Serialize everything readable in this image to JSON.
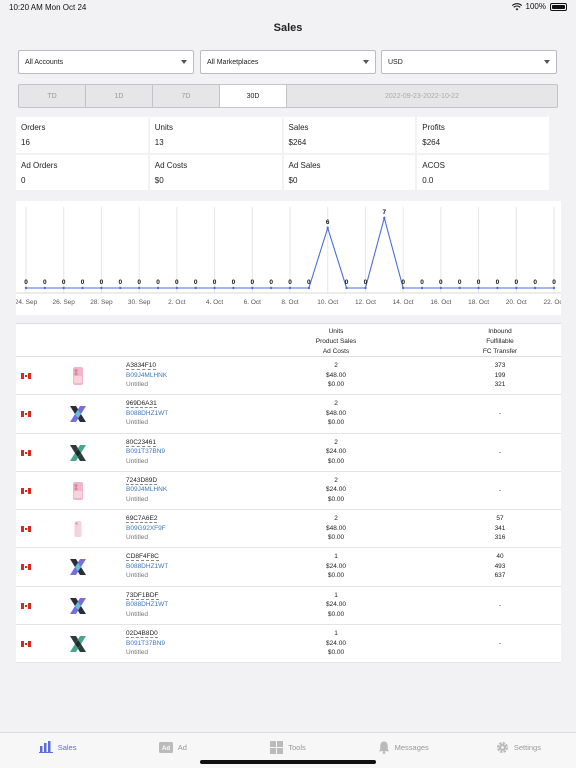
{
  "status": {
    "time": "10:20 AM",
    "date": "Mon Oct 24",
    "battery": "100%"
  },
  "title": "Sales",
  "filters": {
    "accounts": "All Accounts",
    "marketplaces": "All Marketplaces",
    "currency": "USD"
  },
  "periods": [
    "TD",
    "1D",
    "7D",
    "30D"
  ],
  "range": "2022-09-23-2022-10-22",
  "stats": [
    {
      "label": "Orders",
      "value": "16"
    },
    {
      "label": "Units",
      "value": "13"
    },
    {
      "label": "Sales",
      "value": "$264"
    },
    {
      "label": "Profits",
      "value": "$264"
    },
    {
      "label": "Ad Orders",
      "value": "0"
    },
    {
      "label": "Ad Costs",
      "value": "$0"
    },
    {
      "label": "Ad Sales",
      "value": "$0"
    },
    {
      "label": "ACOS",
      "value": "0.0"
    }
  ],
  "chart_data": {
    "type": "line",
    "x": [
      "24. Sep",
      "25. Sep",
      "26. Sep",
      "27. Sep",
      "28. Sep",
      "29. Sep",
      "30. Sep",
      "1. Oct",
      "2. Oct",
      "3. Oct",
      "4. Oct",
      "5. Oct",
      "6. Oct",
      "7. Oct",
      "8. Oct",
      "9. Oct",
      "10. Oct",
      "11. Oct",
      "12. Oct",
      "13. Oct",
      "14. Oct",
      "15. Oct",
      "16. Oct",
      "17. Oct",
      "18. Oct",
      "19. Oct",
      "20. Oct",
      "21. Oct",
      "22. Oct"
    ],
    "tick_labels": [
      "24. Sep",
      "26. Sep",
      "28. Sep",
      "30. Sep",
      "2. Oct",
      "4. Oct",
      "6. Oct",
      "8. Oct",
      "10. Oct",
      "12. Oct",
      "14. Oct",
      "16. Oct",
      "18. Oct",
      "20. Oct",
      "22. Oct"
    ],
    "values": [
      0,
      0,
      0,
      0,
      0,
      0,
      0,
      0,
      0,
      0,
      0,
      0,
      0,
      0,
      0,
      0,
      6,
      0,
      0,
      7,
      0,
      0,
      0,
      0,
      0,
      0,
      0,
      0,
      0
    ],
    "color": "#4a6fd4",
    "grid": true
  },
  "table": {
    "header_mid": [
      "Units",
      "Product Sales",
      "Ad Costs"
    ],
    "header_right": [
      "Inbound",
      "Fulfillable",
      "FC Transfer"
    ],
    "rows": [
      {
        "thumb": "pink-phone-case",
        "sku": "A3834F10",
        "asin": "B09J4MLHNK",
        "name": "Untitled",
        "units": "2",
        "sales": "$48.00",
        "ad": "$0.00",
        "inv": [
          "373",
          "199",
          "321"
        ]
      },
      {
        "thumb": "x-logo-purple",
        "sku": "969D6A31",
        "asin": "B088DHZ1WT",
        "name": "Untitled",
        "units": "2",
        "sales": "$48.00",
        "ad": "$0.00",
        "inv": [
          "-"
        ]
      },
      {
        "thumb": "x-logo-green",
        "sku": "80C23461",
        "asin": "B091T37BN9",
        "name": "Untitled",
        "units": "2",
        "sales": "$24.00",
        "ad": "$0.00",
        "inv": [
          "-"
        ]
      },
      {
        "thumb": "pink-phone-case",
        "sku": "7243D89D",
        "asin": "B09J4MLHNK",
        "name": "Untitled",
        "units": "2",
        "sales": "$24.00",
        "ad": "$0.00",
        "inv": [
          "-"
        ]
      },
      {
        "thumb": "pink-phone-small",
        "sku": "69C7A6E2",
        "asin": "B09G92XF9F",
        "name": "Untitled",
        "units": "2",
        "sales": "$48.00",
        "ad": "$0.00",
        "inv": [
          "57",
          "341",
          "316"
        ]
      },
      {
        "thumb": "x-logo-purple",
        "sku": "CD8F4F8C",
        "asin": "B088DHZ1WT",
        "name": "Untitled",
        "units": "1",
        "sales": "$24.00",
        "ad": "$0.00",
        "inv": [
          "40",
          "493",
          "637"
        ]
      },
      {
        "thumb": "x-logo-purple",
        "sku": "73DF1BDF",
        "asin": "B088DHZ1WT",
        "name": "Untitled",
        "units": "1",
        "sales": "$24.00",
        "ad": "$0.00",
        "inv": [
          "-"
        ]
      },
      {
        "thumb": "x-logo-green",
        "sku": "02D4B8D0",
        "asin": "B091T37BN9",
        "name": "Untitled",
        "units": "1",
        "sales": "$24.00",
        "ad": "$0.00",
        "inv": [
          "-"
        ]
      }
    ]
  },
  "tabs": [
    {
      "label": "Sales",
      "icon": "bar-chart-icon",
      "active": true
    },
    {
      "label": "Ad",
      "icon": "ad-icon",
      "active": false
    },
    {
      "label": "Tools",
      "icon": "grid-icon",
      "active": false
    },
    {
      "label": "Messages",
      "icon": "bell-icon",
      "active": false
    },
    {
      "label": "Settings",
      "icon": "gear-icon",
      "active": false
    }
  ]
}
